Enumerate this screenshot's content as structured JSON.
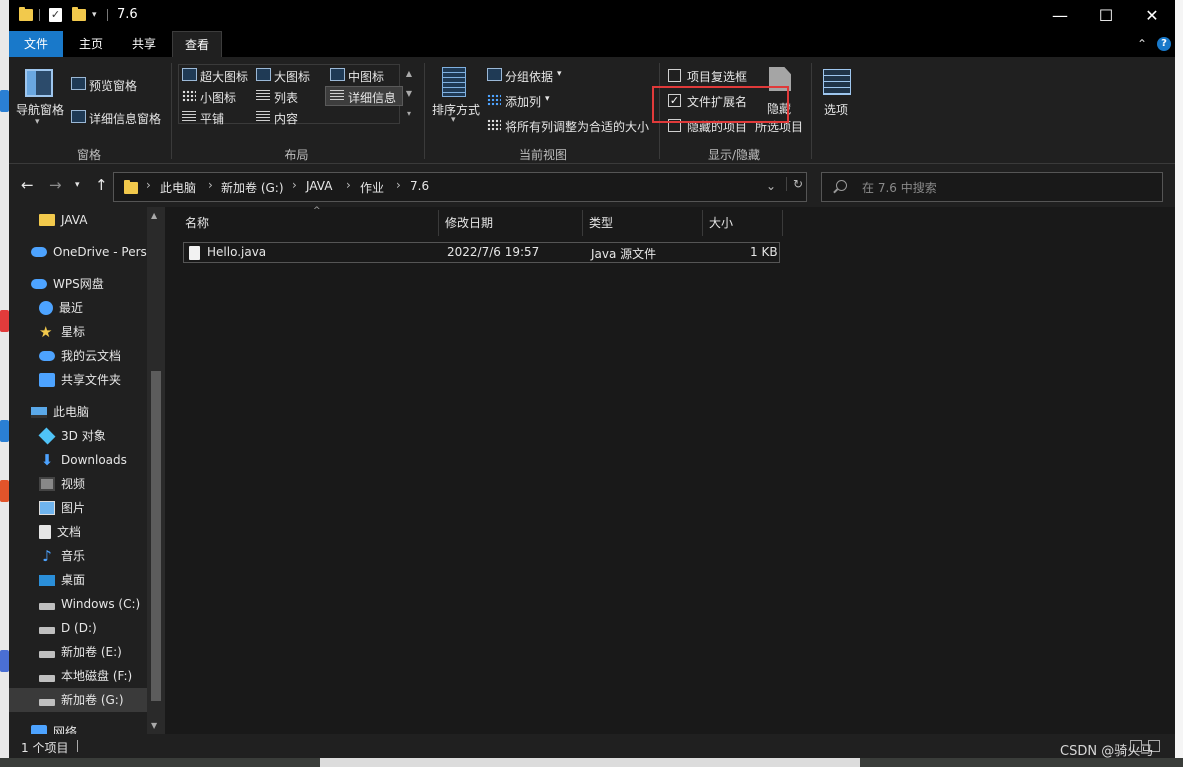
{
  "window": {
    "title": "7.6",
    "minimize": "—",
    "maximize": "☐",
    "close": "✕"
  },
  "ribbon_tabs": [
    "文件",
    "主页",
    "共享",
    "查看"
  ],
  "active_tab": "查看",
  "ribbon": {
    "panes": {
      "nav_pane": "导航窗格",
      "preview_pane": "预览窗格",
      "details_pane": "详细信息窗格",
      "group": "窗格"
    },
    "layout": {
      "items": [
        "超大图标",
        "大图标",
        "中图标",
        "小图标",
        "列表",
        "详细信息",
        "平铺",
        "内容"
      ],
      "selected": "详细信息",
      "group": "布局"
    },
    "current_view": {
      "sort_by": "排序方式",
      "group_by": "分组依据",
      "add_columns": "添加列",
      "size_all_columns": "将所有列调整为合适的大小",
      "group": "当前视图"
    },
    "show_hide": {
      "item_checkboxes": {
        "label": "项目复选框",
        "checked": false
      },
      "file_extensions": {
        "label": "文件扩展名",
        "checked": true
      },
      "hidden_items": {
        "label": "隐藏的项目",
        "checked": false
      },
      "hide_selected": "隐藏",
      "hide_selected_2": "所选项目",
      "group": "显示/隐藏"
    },
    "options": "选项"
  },
  "address": {
    "crumbs": [
      "此电脑",
      "新加卷 (G:)",
      "JAVA",
      "作业",
      "7.6"
    ],
    "search_placeholder": "在 7.6 中搜索"
  },
  "nav_pane": {
    "items": [
      {
        "label": "JAVA",
        "icon": "folder-icon"
      },
      {
        "label": "OneDrive - Perso",
        "icon": "onedrive-icon"
      },
      {
        "label": "WPS网盘",
        "icon": "wps-cloud-icon"
      },
      {
        "label": "最近",
        "icon": "clock-icon"
      },
      {
        "label": "星标",
        "icon": "star-icon"
      },
      {
        "label": "我的云文档",
        "icon": "cloud-doc-icon"
      },
      {
        "label": "共享文件夹",
        "icon": "share-folder-icon"
      },
      {
        "label": "此电脑",
        "icon": "computer-icon"
      },
      {
        "label": "3D 对象",
        "icon": "cube-icon"
      },
      {
        "label": "Downloads",
        "icon": "download-icon"
      },
      {
        "label": "视频",
        "icon": "video-icon"
      },
      {
        "label": "图片",
        "icon": "picture-icon"
      },
      {
        "label": "文档",
        "icon": "document-icon"
      },
      {
        "label": "音乐",
        "icon": "music-icon"
      },
      {
        "label": "桌面",
        "icon": "desktop-icon"
      },
      {
        "label": "Windows (C:)",
        "icon": "drive-icon"
      },
      {
        "label": "D (D:)",
        "icon": "drive-icon"
      },
      {
        "label": "新加卷 (E:)",
        "icon": "drive-icon"
      },
      {
        "label": "本地磁盘 (F:)",
        "icon": "drive-icon"
      },
      {
        "label": "新加卷 (G:)",
        "icon": "drive-icon"
      },
      {
        "label": "网络",
        "icon": "network-icon"
      }
    ],
    "selected": "新加卷 (G:)"
  },
  "file_list": {
    "columns": [
      "名称",
      "修改日期",
      "类型",
      "大小"
    ],
    "rows": [
      {
        "name": "Hello.java",
        "modified": "2022/7/6 19:57",
        "type": "Java 源文件",
        "size": "1 KB"
      }
    ]
  },
  "status": {
    "count": "1 个项目"
  },
  "watermark": "CSDN @骑火马",
  "highlight_color": "#e03a3a",
  "accent_color": "#1979ca"
}
